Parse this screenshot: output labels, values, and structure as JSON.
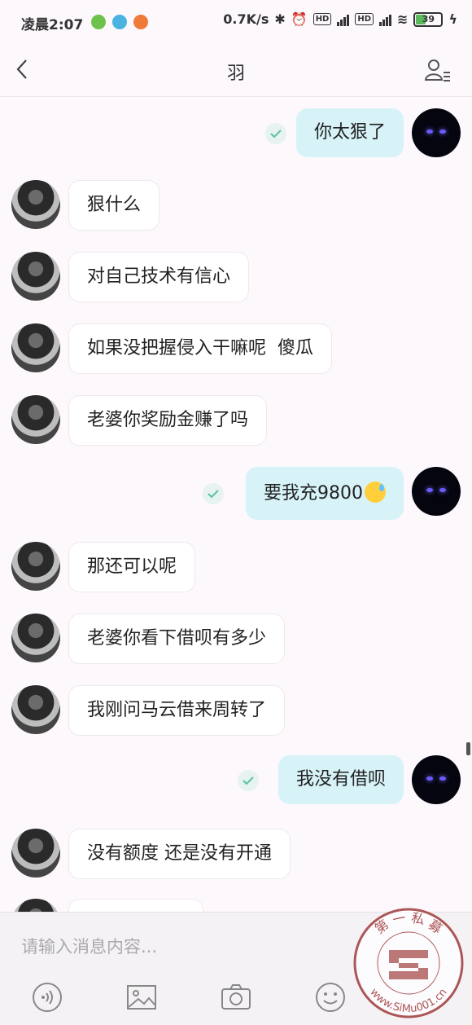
{
  "status_bar": {
    "time": "凌晨2:07",
    "net_speed": "0.7K/s",
    "hd1": "HD",
    "hd2": "HD",
    "battery": "39"
  },
  "header": {
    "title": "羽"
  },
  "messages": [
    {
      "side": "out",
      "text": "你太狠了",
      "read": true
    },
    {
      "side": "in",
      "text": "狠什么"
    },
    {
      "side": "in",
      "text": "对自己技术有信心"
    },
    {
      "side": "in",
      "text": "如果没把握侵入干嘛呢  傻瓜"
    },
    {
      "side": "in",
      "text": "老婆你奖励金赚了吗"
    },
    {
      "side": "out",
      "text": "要我充9800",
      "read": true,
      "emoji": "sweat-smile-emoji"
    },
    {
      "side": "in",
      "text": "那还可以呢"
    },
    {
      "side": "in",
      "text": "老婆你看下借呗有多少"
    },
    {
      "side": "in",
      "text": "我刚问马云借来周转了"
    },
    {
      "side": "out",
      "text": "我没有借呗",
      "read": true
    },
    {
      "side": "in",
      "text": "没有额度 还是没有开通"
    }
  ],
  "input": {
    "placeholder": "请输入消息内容..."
  },
  "toolbar": {
    "icons": [
      "voice-icon",
      "image-icon",
      "camera-icon",
      "emoji-icon"
    ]
  },
  "watermark": {
    "top_text": "第 一 私 募",
    "url_text": "www.SiMu001.cn"
  },
  "colors": {
    "outgoing_bubble": "#d7f3f8",
    "incoming_bubble": "#ffffff",
    "background": "#fcf8fc",
    "read_check": "#5bbfa8"
  }
}
